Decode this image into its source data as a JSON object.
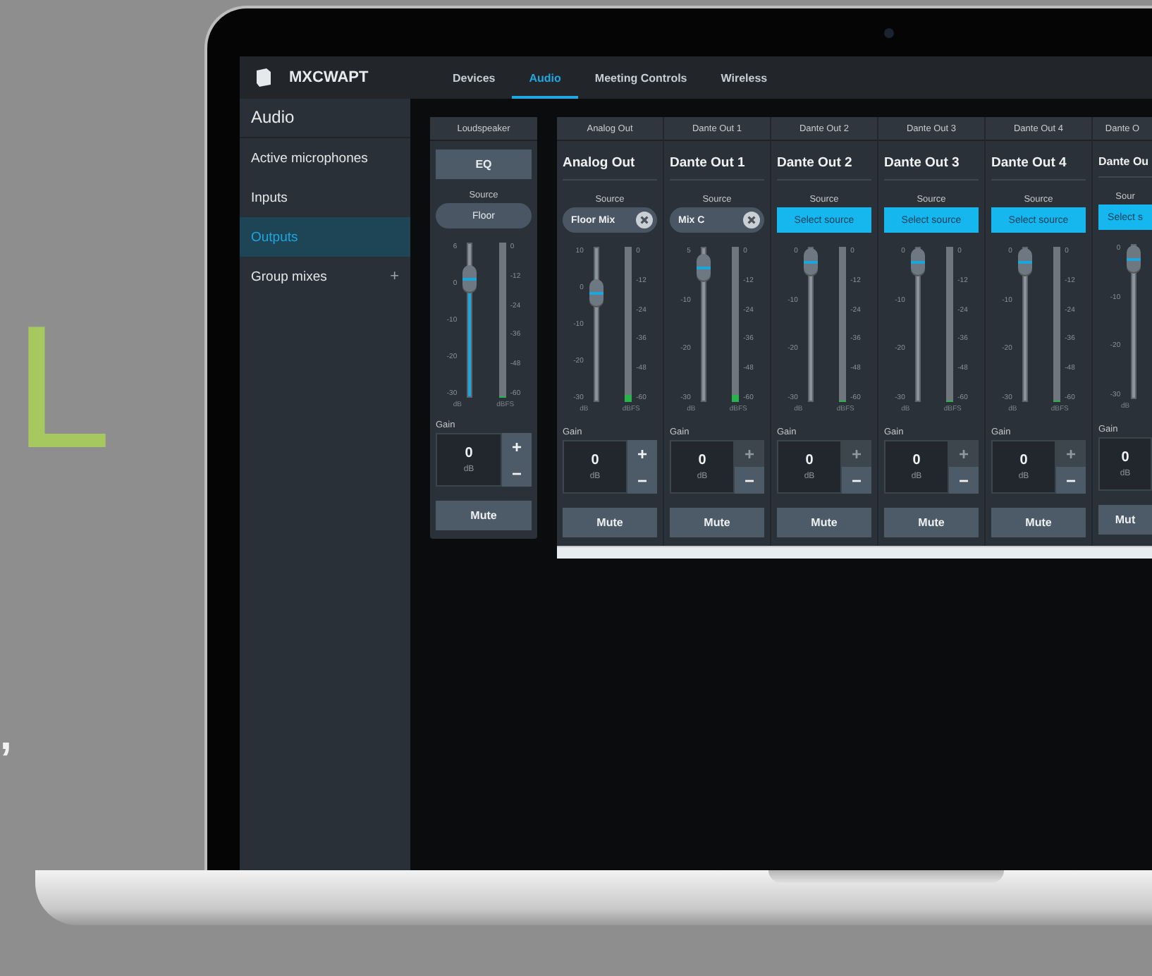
{
  "side_text": [
    {
      "text": "L",
      "kind": "accent"
    },
    {
      "text": ",",
      "kind": "plain"
    }
  ],
  "app": {
    "name": "MXCWAPT"
  },
  "tabs": [
    {
      "label": "Devices",
      "selected": false
    },
    {
      "label": "Audio",
      "selected": true
    },
    {
      "label": "Meeting Controls",
      "selected": false
    },
    {
      "label": "Wireless",
      "selected": false
    }
  ],
  "sidebar": {
    "title": "Audio",
    "items": [
      {
        "label": "Active microphones",
        "selected": false
      },
      {
        "label": "Inputs",
        "selected": false
      },
      {
        "label": "Outputs",
        "selected": true
      },
      {
        "label": "Group mixes",
        "selected": false,
        "add": "+"
      }
    ]
  },
  "loudspeaker": {
    "header": "Loudspeaker",
    "eq": "EQ",
    "source_label": "Source",
    "source": "Floor",
    "fader": {
      "ticks": [
        "6",
        "0",
        "-10",
        "-20",
        "-30"
      ],
      "level": 0.83,
      "highlighted": true,
      "unit": "dB"
    },
    "meter": {
      "ticks": [
        "0",
        "-12",
        "-24",
        "-36",
        "-48",
        "-60"
      ],
      "level": 0,
      "unit": "dBFS"
    },
    "gain": {
      "label": "Gain",
      "value": "0",
      "unit": "dB",
      "plus": "+",
      "minus": "−",
      "plus_disabled": false
    },
    "mute": "Mute"
  },
  "outputs": [
    {
      "header": "Analog Out",
      "title": "Analog Out",
      "source_label": "Source",
      "source": {
        "kind": "chip",
        "value": "Floor Mix"
      },
      "fader": {
        "ticks": [
          "10",
          "0",
          "-10",
          "-20",
          "-30"
        ],
        "level": 0.75,
        "highlighted": false,
        "unit": "dB"
      },
      "meter": {
        "ticks": [
          "0",
          "-12",
          "-24",
          "-36",
          "-48",
          "-60"
        ],
        "level": 0.05,
        "unit": "dBFS"
      },
      "gain": {
        "label": "Gain",
        "value": "0",
        "unit": "dB",
        "plus": "+",
        "minus": "−",
        "plus_disabled": false
      },
      "mute": "Mute",
      "clipped": false
    },
    {
      "header": "Dante Out 1",
      "title": "Dante Out 1",
      "source_label": "Source",
      "source": {
        "kind": "chip",
        "value": "Mix C"
      },
      "fader": {
        "ticks": [
          "5",
          "-10",
          "-20",
          "-30"
        ],
        "level": 0.95,
        "highlighted": false,
        "unit": "dB"
      },
      "meter": {
        "ticks": [
          "0",
          "-12",
          "-24",
          "-36",
          "-48",
          "-60"
        ],
        "level": 0.05,
        "unit": "dBFS"
      },
      "gain": {
        "label": "Gain",
        "value": "0",
        "unit": "dB",
        "plus": "+",
        "minus": "−",
        "plus_disabled": true
      },
      "mute": "Mute",
      "clipped": false
    },
    {
      "header": "Dante Out 2",
      "title": "Dante Out 2",
      "source_label": "Source",
      "source": {
        "kind": "select",
        "value": "Select source"
      },
      "fader": {
        "ticks": [
          "0",
          "-10",
          "-20",
          "-30"
        ],
        "level": 1,
        "highlighted": false,
        "unit": "dB"
      },
      "meter": {
        "ticks": [
          "0",
          "-12",
          "-24",
          "-36",
          "-48",
          "-60"
        ],
        "level": 0,
        "unit": "dBFS"
      },
      "gain": {
        "label": "Gain",
        "value": "0",
        "unit": "dB",
        "plus": "+",
        "minus": "−",
        "plus_disabled": true
      },
      "mute": "Mute",
      "clipped": false
    },
    {
      "header": "Dante Out 3",
      "title": "Dante Out 3",
      "source_label": "Source",
      "source": {
        "kind": "select",
        "value": "Select source"
      },
      "fader": {
        "ticks": [
          "0",
          "-10",
          "-20",
          "-30"
        ],
        "level": 1,
        "highlighted": false,
        "unit": "dB"
      },
      "meter": {
        "ticks": [
          "0",
          "-12",
          "-24",
          "-36",
          "-48",
          "-60"
        ],
        "level": 0,
        "unit": "dBFS"
      },
      "gain": {
        "label": "Gain",
        "value": "0",
        "unit": "dB",
        "plus": "+",
        "minus": "−",
        "plus_disabled": true
      },
      "mute": "Mute",
      "clipped": false
    },
    {
      "header": "Dante Out 4",
      "title": "Dante Out 4",
      "source_label": "Source",
      "source": {
        "kind": "select",
        "value": "Select source"
      },
      "fader": {
        "ticks": [
          "0",
          "-10",
          "-20",
          "-30"
        ],
        "level": 1,
        "highlighted": false,
        "unit": "dB"
      },
      "meter": {
        "ticks": [
          "0",
          "-12",
          "-24",
          "-36",
          "-48",
          "-60"
        ],
        "level": 0,
        "unit": "dBFS"
      },
      "gain": {
        "label": "Gain",
        "value": "0",
        "unit": "dB",
        "plus": "+",
        "minus": "−",
        "plus_disabled": true
      },
      "mute": "Mute",
      "clipped": false
    },
    {
      "header": "Dante O",
      "title": "Dante Ou",
      "source_label": "Sour",
      "source": {
        "kind": "select",
        "value": "Select s"
      },
      "fader": {
        "ticks": [
          "0",
          "-10",
          "-20",
          "-30"
        ],
        "level": 1,
        "highlighted": false,
        "unit": "dB"
      },
      "gain": {
        "label": "Gain",
        "value": "0",
        "unit": "dB"
      },
      "mute": "Mut",
      "clipped": true
    }
  ]
}
